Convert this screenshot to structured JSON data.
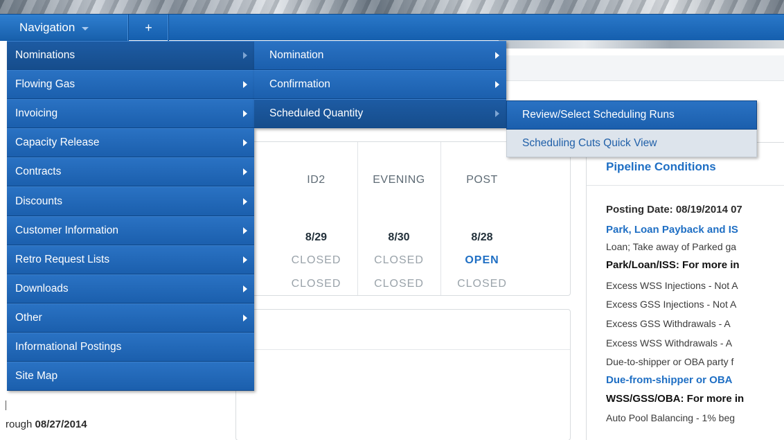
{
  "navbar": {
    "navigation_label": "Navigation",
    "plus_label": "+"
  },
  "menu": {
    "items": [
      {
        "label": "Nominations",
        "has_submenu": true
      },
      {
        "label": "Flowing Gas",
        "has_submenu": true
      },
      {
        "label": "Invoicing",
        "has_submenu": true
      },
      {
        "label": "Capacity Release",
        "has_submenu": true
      },
      {
        "label": "Contracts",
        "has_submenu": true
      },
      {
        "label": "Discounts",
        "has_submenu": true
      },
      {
        "label": "Customer Information",
        "has_submenu": true
      },
      {
        "label": "Retro Request Lists",
        "has_submenu": true
      },
      {
        "label": "Downloads",
        "has_submenu": true
      },
      {
        "label": "Other",
        "has_submenu": true
      },
      {
        "label": "Informational Postings",
        "has_submenu": false
      },
      {
        "label": "Site Map",
        "has_submenu": false
      }
    ],
    "active_item": "Nominations"
  },
  "submenu": {
    "items": [
      {
        "label": "Nomination"
      },
      {
        "label": "Confirmation"
      },
      {
        "label": "Scheduled Quantity"
      }
    ],
    "active_item": "Scheduled Quantity"
  },
  "submenu3": {
    "items": [
      {
        "label": "Review/Select Scheduling Runs"
      },
      {
        "label": "Scheduling Cuts Quick View"
      }
    ],
    "highlighted_item": "Review/Select Scheduling Runs"
  },
  "schedule": {
    "columns": [
      {
        "header": "ID2",
        "date": "8/29",
        "status1": "CLOSED",
        "status2": "CLOSED"
      },
      {
        "header": "EVENING",
        "date": "8/30",
        "status1": "CLOSED",
        "status2": "CLOSED"
      },
      {
        "header": "POST",
        "date": "8/28",
        "status1": "OPEN",
        "status2": "CLOSED"
      }
    ]
  },
  "through_text": {
    "prefix": "rough ",
    "date": "08/27/2014"
  },
  "pipeline": {
    "title": "Pipeline Conditions",
    "lines": [
      {
        "text": "Posting Date: 08/19/2014 07",
        "style": "posting"
      },
      {
        "text": "Park, Loan Payback and IS",
        "style": "link"
      },
      {
        "text": "Loan; Take away of Parked ga",
        "style": "plain"
      },
      {
        "text": "Park/Loan/ISS: For more in",
        "style": "bold"
      },
      {
        "text": "Excess WSS Injections - Not A",
        "style": "plain"
      },
      {
        "text": "Excess GSS Injections - Not A",
        "style": "plain"
      },
      {
        "text": "Excess GSS Withdrawals - A",
        "style": "plain"
      },
      {
        "text": "Excess WSS Withdrawals - A",
        "style": "plain"
      },
      {
        "text": "Due-to-shipper or OBA party f",
        "style": "plain"
      },
      {
        "text": "Due-from-shipper or OBA",
        "style": "link"
      },
      {
        "text": "WSS/GSS/OBA: For more in",
        "style": "bold"
      },
      {
        "text": "Auto Pool Balancing - 1% beg",
        "style": "plain"
      }
    ]
  },
  "colors": {
    "navbar": "#1f6cbd",
    "menu_item": "#2266b6",
    "link_blue": "#1f6fc4",
    "open_status": "#1f6fc4",
    "closed_status": "#9aa3aa"
  }
}
